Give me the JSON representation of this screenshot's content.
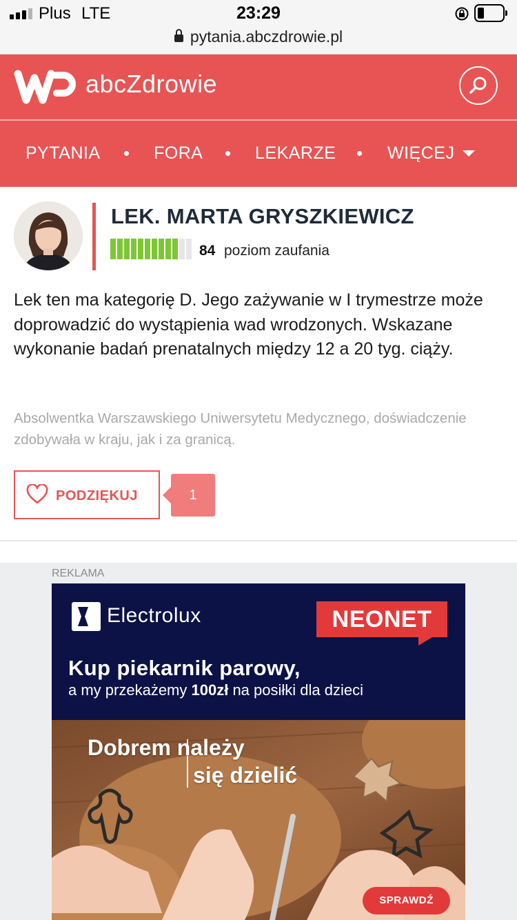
{
  "status_bar": {
    "carrier": "Plus",
    "network": "LTE",
    "time": "23:29"
  },
  "browser": {
    "url": "pytania.abczdrowie.pl"
  },
  "header": {
    "brand": "abcZdrowie"
  },
  "nav": {
    "items": [
      "PYTANIA",
      "FORA",
      "LEKARZE",
      "WIĘCEJ"
    ]
  },
  "answer": {
    "doctor_name": "LEK. MARTA GRYSZKIEWICZ",
    "trust_level": 84,
    "trust_level_fraction": 0.84,
    "trust_label": "poziom zaufania",
    "text": "Lek ten ma kategorię D. Jego zażywanie w I trymestrze może doprowadzić do wystąpienia wad wrodzonych. Wskazane wykonanie badań prenatalnych między 12 a 20 tyg. ciąży.",
    "bio": "Absolwentka Warszawskiego Uniwersytetu Medycznego, doświadczenie zdobywała w kraju, jak i za granicą.",
    "thanks_label": "PODZIĘKUJ",
    "thanks_count": "1"
  },
  "ad": {
    "label": "REKLAMA",
    "brand_left": "Electrolux",
    "brand_right": "NEONET",
    "headline": "Kup piekarnik parowy,",
    "subline_pre": "a my przekażemy ",
    "subline_amount": "100zł",
    "subline_post": " na posiłki dla dzieci",
    "slogan_line1": "Dobrem należy",
    "slogan_line2": "się dzielić",
    "cta": "SPRAWDŹ"
  },
  "colors": {
    "brand_red": "#e85454",
    "trust_green": "#7dc734",
    "ad_navy": "#0c1245"
  },
  "icons": [
    "signal-icon",
    "padlock-icon",
    "rotation-lock-icon",
    "battery-icon",
    "wp-logo-icon",
    "search-icon",
    "chevron-down-icon",
    "heart-icon",
    "electrolux-logo-icon"
  ]
}
